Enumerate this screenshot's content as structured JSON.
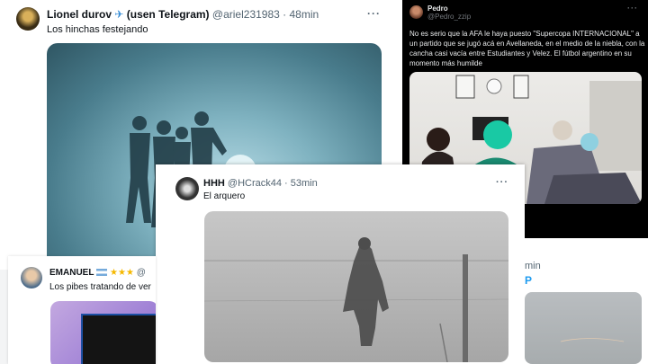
{
  "colors": {
    "light_bg": "#ffffff",
    "dark_bg": "#000000",
    "handle_gray": "#536471",
    "link_blue": "#1d9bf0"
  },
  "tweet1": {
    "name": "Lionel durov",
    "suffix": "(usen Telegram)",
    "handle": "@ariel231983",
    "sep": "·",
    "time": "48min",
    "text": "Los hinchas festejando",
    "more": "···",
    "icon": "airplane-icon"
  },
  "tweet2": {
    "name": "Pedro",
    "handle": "@Pedro_zzip",
    "more": "···",
    "text": "No es serio que la AFA le haya puesto \"Supercopa INTERNACIONAL\" a un partido que se jugó acá en Avellaneda, en el medio de la niebla, con la cancha casi vacía entre Estudiantes y Velez. El fútbol argentino en su momento más humilde"
  },
  "tweet3": {
    "name": "HHH",
    "handle": "@HCrack44",
    "sep": "·",
    "time": "53min",
    "text": "El arquero",
    "more": "···"
  },
  "tweet4": {
    "name": "EMANUEL",
    "handle": "@",
    "text": "Los pibes tratando de ver",
    "icons": [
      "argentina-flag-icon",
      "star-icon",
      "star-icon",
      "star-icon"
    ]
  },
  "tweet5": {
    "time_fragment": "min",
    "link_fragment": "P"
  }
}
